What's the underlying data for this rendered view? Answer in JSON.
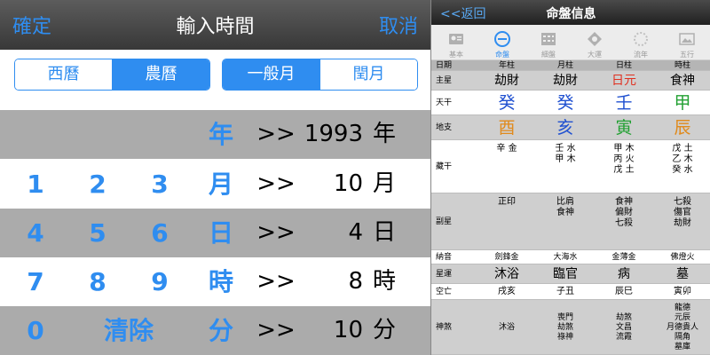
{
  "left": {
    "confirm": "確定",
    "title": "輸入時間",
    "cancel": "取消",
    "calendar": {
      "western": "西曆",
      "lunar": "農曆"
    },
    "month_type": {
      "normal": "一般月",
      "leap": "閏月"
    },
    "rows": [
      {
        "keys": [
          "",
          "",
          ""
        ],
        "unit_key": "年",
        "arrow": ">>",
        "value": "1993",
        "unit": "年"
      },
      {
        "keys": [
          "1",
          "2",
          "3"
        ],
        "unit_key": "月",
        "arrow": ">>",
        "value": "10",
        "unit": "月"
      },
      {
        "keys": [
          "4",
          "5",
          "6"
        ],
        "unit_key": "日",
        "arrow": ">>",
        "value": "4",
        "unit": "日"
      },
      {
        "keys": [
          "7",
          "8",
          "9"
        ],
        "unit_key": "時",
        "arrow": ">>",
        "value": "8",
        "unit": "時"
      },
      {
        "keys": [
          "0",
          "清除",
          ""
        ],
        "unit_key": "分",
        "arrow": ">>",
        "value": "10",
        "unit": "分"
      }
    ]
  },
  "right": {
    "back": "<<返回",
    "title": "命盤信息",
    "tabs": [
      {
        "label": "基本",
        "icon": "profile-icon"
      },
      {
        "label": "命盤",
        "icon": "chart-circle-icon"
      },
      {
        "label": "細盤",
        "icon": "grid-icon"
      },
      {
        "label": "大運",
        "icon": "diamond-icon"
      },
      {
        "label": "流年",
        "icon": "ring-icon"
      },
      {
        "label": "五行",
        "icon": "image-icon"
      }
    ],
    "columns": {
      "label": "日期",
      "year": "年柱",
      "month": "月柱",
      "day": "日柱",
      "hour": "時柱"
    },
    "main_star": {
      "label": "主星",
      "values": [
        "劫財",
        "劫財",
        "日元",
        "食神"
      ]
    },
    "heaven": {
      "label": "天干",
      "values": [
        "癸",
        "癸",
        "壬",
        "甲"
      ]
    },
    "earth": {
      "label": "地支",
      "values": [
        "酉",
        "亥",
        "寅",
        "辰"
      ]
    },
    "hidden": {
      "label": "藏干",
      "values": [
        [
          "辛 金"
        ],
        [
          "壬 水",
          "甲 木"
        ],
        [
          "甲 木",
          "丙 火",
          "戊 土"
        ],
        [
          "戊 土",
          "乙 木",
          "癸 水"
        ]
      ]
    },
    "sub_star": {
      "label": "副星",
      "values": [
        [
          "正印"
        ],
        [
          "比肩",
          "食神"
        ],
        [
          "食神",
          "偏財",
          "七殺"
        ],
        [
          "七殺",
          "傷官",
          "劫財"
        ]
      ]
    },
    "nayin": {
      "label": "納音",
      "values": [
        "劍鋒金",
        "大海水",
        "金薄金",
        "佛燈火"
      ]
    },
    "star_fortune": {
      "label": "星運",
      "values": [
        "沐浴",
        "臨官",
        "病",
        "墓"
      ]
    },
    "void": {
      "label": "空亡",
      "values": [
        "戌亥",
        "子丑",
        "辰巳",
        "寅卯"
      ]
    },
    "shensha": {
      "label": "神煞",
      "values": [
        [
          "沐浴"
        ],
        [
          "喪門",
          "劫煞",
          "祿神"
        ],
        [
          "劫煞",
          "文昌",
          "流霞"
        ],
        [
          "龍德",
          "元辰",
          "月德貴人",
          "隔角",
          "墓庫"
        ]
      ]
    },
    "colors": {
      "red": "#e03020",
      "blue": "#1f50d0",
      "green": "#22a032",
      "orange": "#e08a1c",
      "tab_active": "#2f8df0"
    }
  }
}
